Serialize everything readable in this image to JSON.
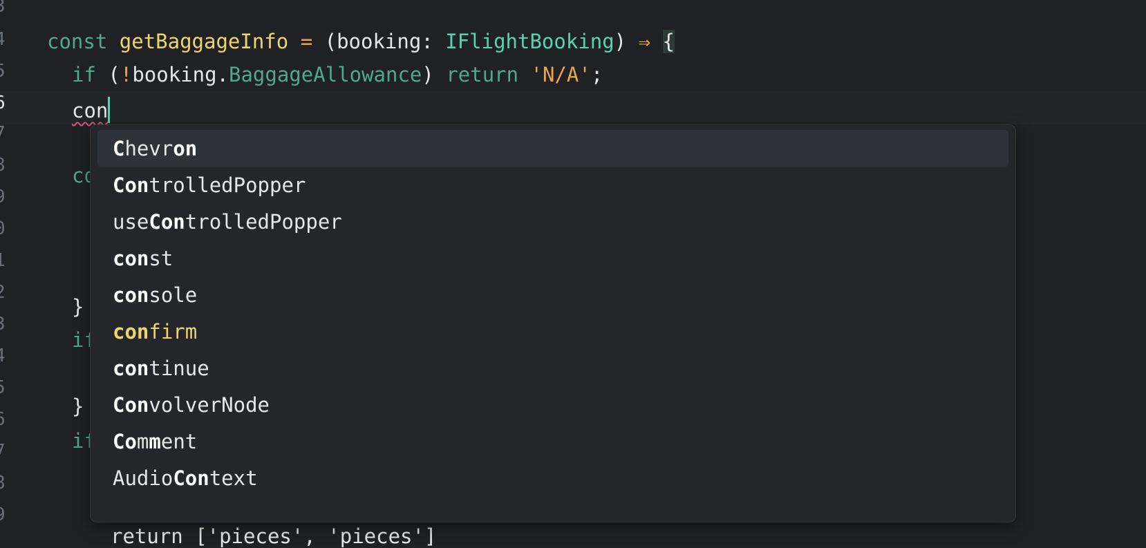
{
  "editor": {
    "line_numbers": [
      "3",
      "4",
      "5",
      "6",
      "7",
      "8",
      "9",
      "0",
      "1",
      "2",
      "3",
      "4",
      "5",
      "6",
      "7",
      "8",
      "9"
    ],
    "current_line_index": 3,
    "line4": {
      "const_kw": "const",
      "fn_name": "getBaggageInfo",
      "eq": "=",
      "open_paren": "(",
      "param": "booking",
      "colon": ": ",
      "type": "IFlightBooking",
      "close_paren": ")",
      "arrow": "⇒",
      "brace": "{"
    },
    "line5": {
      "if_kw": "if",
      "paren_open": "(",
      "bang": "!",
      "obj": "booking",
      "dot": ".",
      "prop": "BaggageAllowance",
      "paren_close": ")",
      "return_kw": "return",
      "str": "'N/A'",
      "semi": ";"
    },
    "line6": {
      "typed": "con"
    },
    "partial": {
      "l8": "co",
      "l12": "}",
      "l13": "if",
      "l15": "}",
      "l16": "if",
      "l19": "return ['pieces', 'pieces']"
    }
  },
  "autocomplete": {
    "selected_index": 0,
    "items": [
      {
        "pre": "",
        "bold": "C",
        "mid": "hevr",
        "bold2": "on",
        "post": ""
      },
      {
        "pre": "",
        "bold": "Con",
        "mid": "trolledPopper",
        "bold2": "",
        "post": ""
      },
      {
        "pre": "use",
        "bold": "Con",
        "mid": "trolledPopper",
        "bold2": "",
        "post": ""
      },
      {
        "pre": "",
        "bold": "con",
        "mid": "st",
        "bold2": "",
        "post": ""
      },
      {
        "pre": "",
        "bold": "con",
        "mid": "sole",
        "bold2": "",
        "post": ""
      },
      {
        "pre": "",
        "bold": "con",
        "mid": "firm",
        "bold2": "",
        "post": ""
      },
      {
        "pre": "",
        "bold": "con",
        "mid": "tinue",
        "bold2": "",
        "post": ""
      },
      {
        "pre": "",
        "bold": "Con",
        "mid": "volverNode",
        "bold2": "",
        "post": ""
      },
      {
        "pre": "",
        "bold": "Co",
        "mid": "m",
        "bold2": "m",
        "post": "ent"
      },
      {
        "pre": "Audio",
        "bold": "Con",
        "mid": "text",
        "bold2": "",
        "post": ""
      }
    ],
    "keyword_item_index": 5
  },
  "colors": {
    "background": "#1f2125",
    "keyword": "#4fa98a",
    "function": "#f0d56a",
    "type": "#57d3b3",
    "string": "#e8a54a",
    "popup_bg": "#24262b",
    "selected_bg": "#2e323a"
  }
}
